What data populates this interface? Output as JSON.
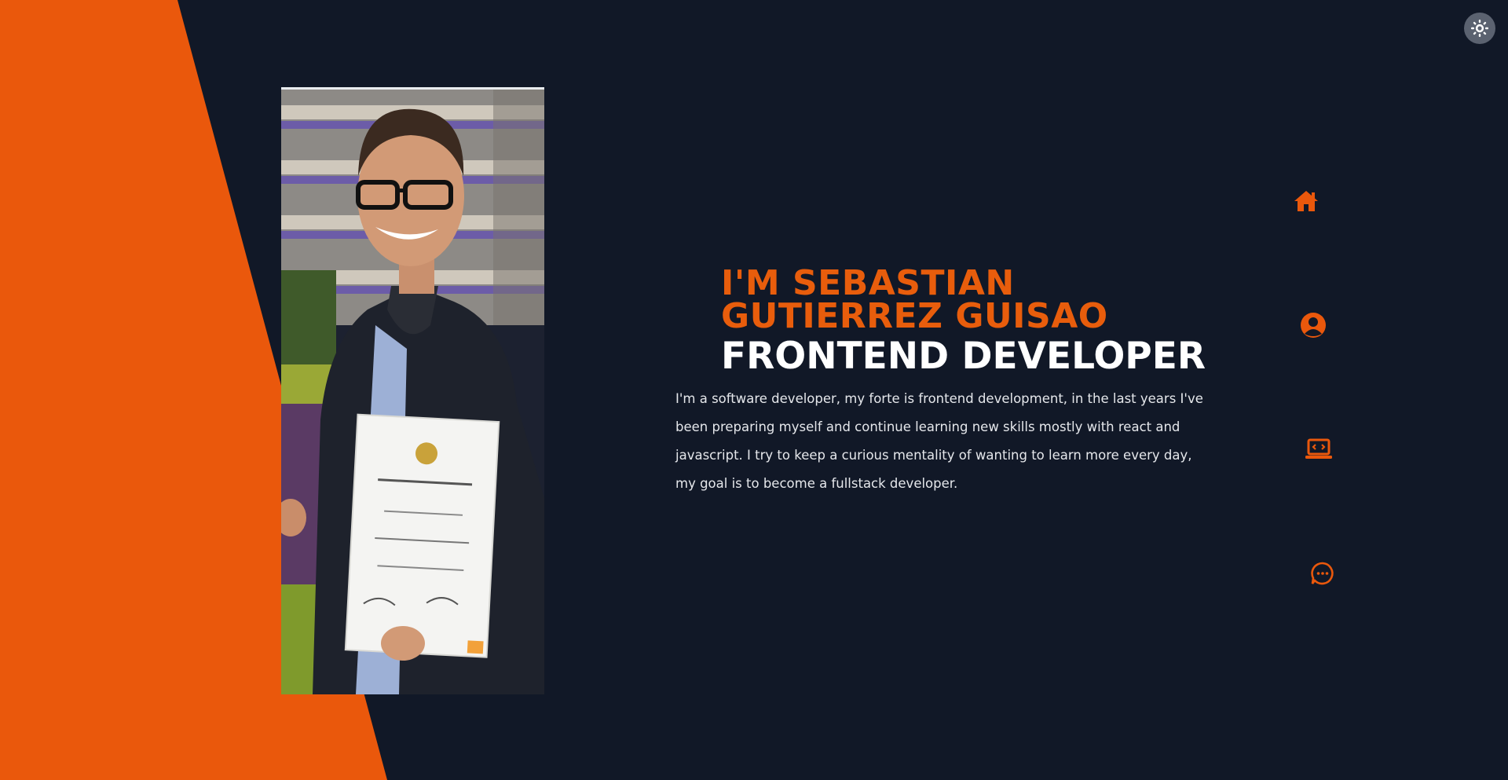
{
  "theme": {
    "accent": "#e85d0c",
    "background": "#111827",
    "text": "#ffffff",
    "toggle_icon": "sun-icon"
  },
  "photo": {
    "subject": "profile-photo"
  },
  "hero": {
    "name": "I'M SEBASTIAN GUTIERREZ GUISAO",
    "role": "FRONTEND DEVELOPER",
    "bio": "I'm a software developer, my forte is frontend development, in the last years I've been preparing myself and continue learning new skills mostly with react and javascript. I try to keep a curious mentality of wanting to learn more every day, my goal is to become a fullstack developer."
  },
  "nav": {
    "items": [
      {
        "icon": "home-icon"
      },
      {
        "icon": "user-circle-icon"
      },
      {
        "icon": "laptop-code-icon"
      },
      {
        "icon": "chat-bubble-icon"
      }
    ]
  }
}
